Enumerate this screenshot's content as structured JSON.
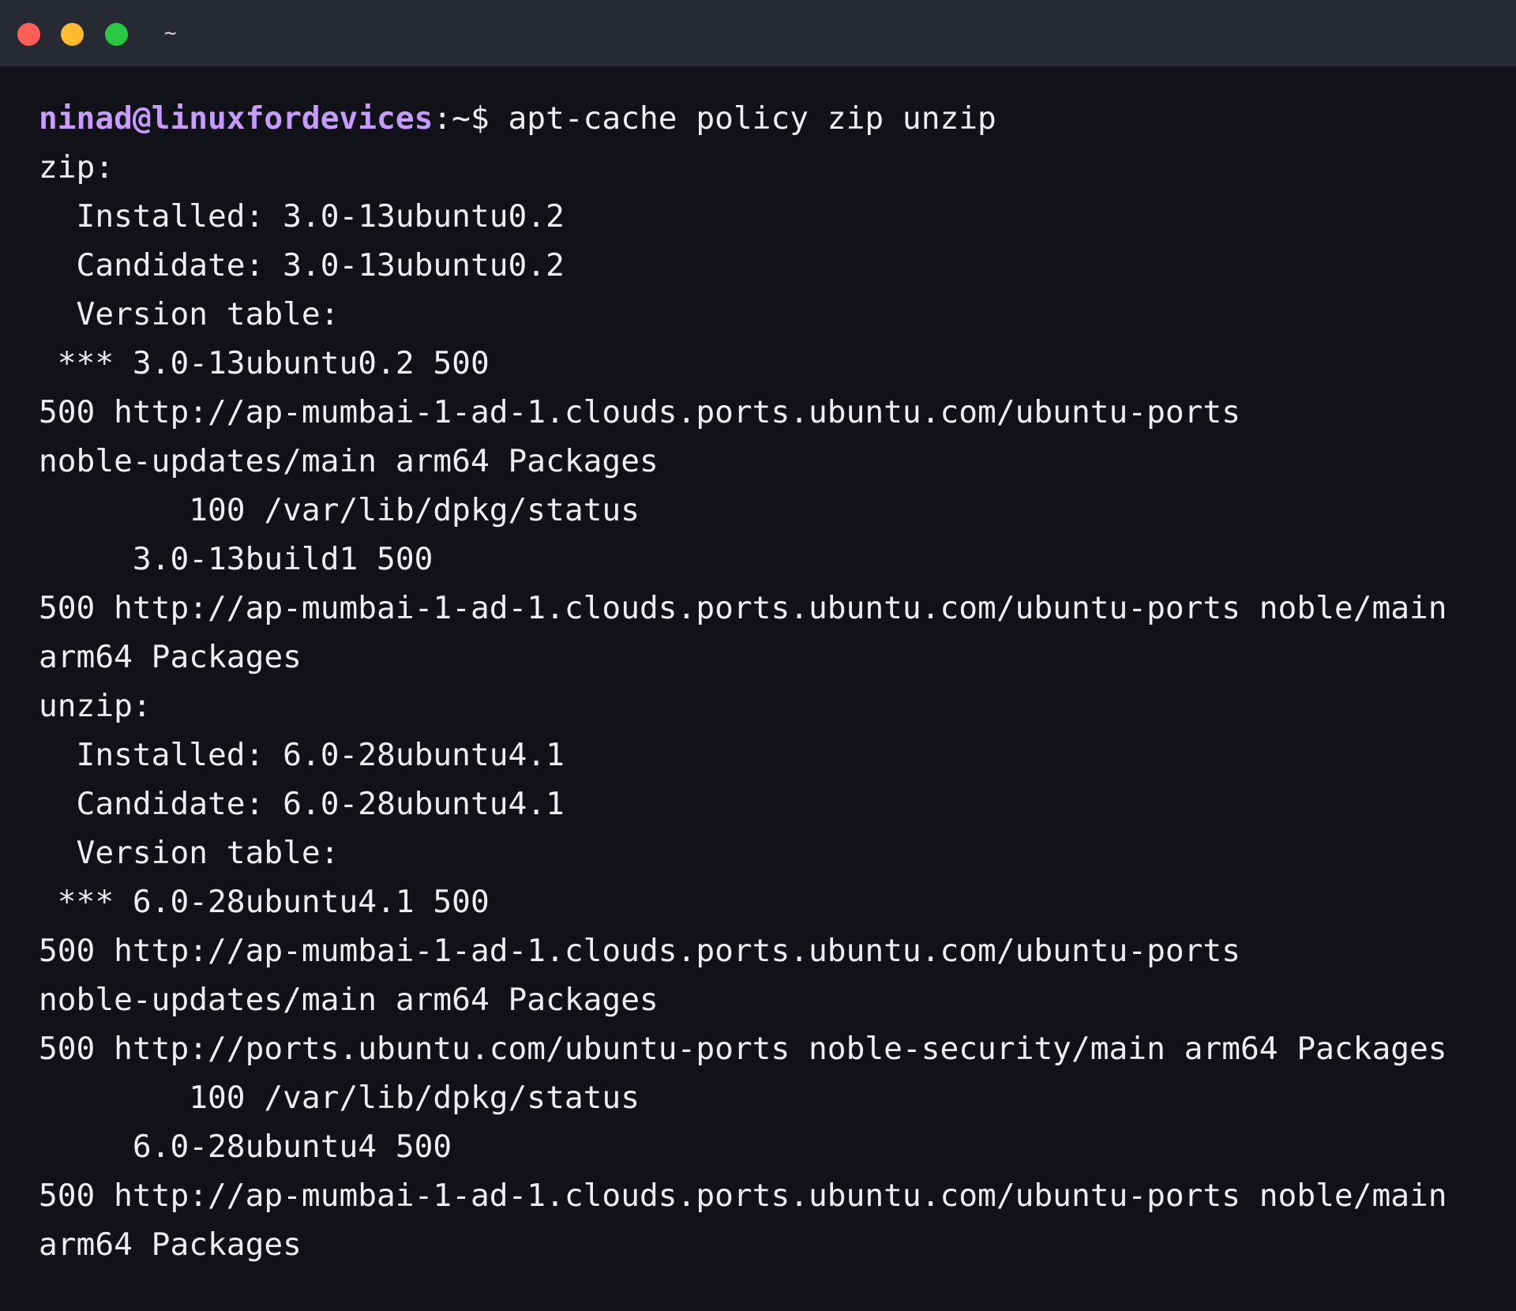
{
  "window": {
    "title": "~",
    "traffic_lights": {
      "close": "#ff5f57",
      "minimize": "#febc2e",
      "maximize": "#28c840"
    }
  },
  "colors": {
    "background": "#111217",
    "titlebar": "#282a33",
    "text": "#eceef2",
    "prompt_user": "#c79bff"
  },
  "prompt": {
    "user_host": "ninad@linuxfordevices",
    "path_symbol": ":~$ ",
    "command": "apt-cache policy zip unzip"
  },
  "output_lines": [
    "zip:",
    "  Installed: 3.0-13ubuntu0.2",
    "  Candidate: 3.0-13ubuntu0.2",
    "  Version table:",
    " *** 3.0-13ubuntu0.2 500",
    "500 http://ap-mumbai-1-ad-1.clouds.ports.ubuntu.com/ubuntu-ports",
    "noble-updates/main arm64 Packages",
    "        100 /var/lib/dpkg/status",
    "     3.0-13build1 500",
    "500 http://ap-mumbai-1-ad-1.clouds.ports.ubuntu.com/ubuntu-ports noble/main",
    "arm64 Packages",
    "unzip:",
    "  Installed: 6.0-28ubuntu4.1",
    "  Candidate: 6.0-28ubuntu4.1",
    "  Version table:",
    " *** 6.0-28ubuntu4.1 500",
    "500 http://ap-mumbai-1-ad-1.clouds.ports.ubuntu.com/ubuntu-ports",
    "noble-updates/main arm64 Packages",
    "500 http://ports.ubuntu.com/ubuntu-ports noble-security/main arm64 Packages",
    "        100 /var/lib/dpkg/status",
    "     6.0-28ubuntu4 500",
    "500 http://ap-mumbai-1-ad-1.clouds.ports.ubuntu.com/ubuntu-ports noble/main",
    "arm64 Packages"
  ]
}
